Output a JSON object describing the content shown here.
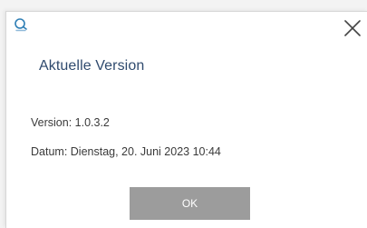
{
  "dialog": {
    "title": "Aktuelle Version",
    "version_line": "Version: 1.0.3.2",
    "date_line": "Datum: Dienstag, 20. Juni 2023 10:44",
    "ok_label": "OK",
    "icons": {
      "app": "app-logo-icon",
      "close": "close-icon"
    },
    "colors": {
      "title": "#2f4a6e",
      "button": "#9c9c9c",
      "icon_accent": "#2f7fb5"
    }
  }
}
